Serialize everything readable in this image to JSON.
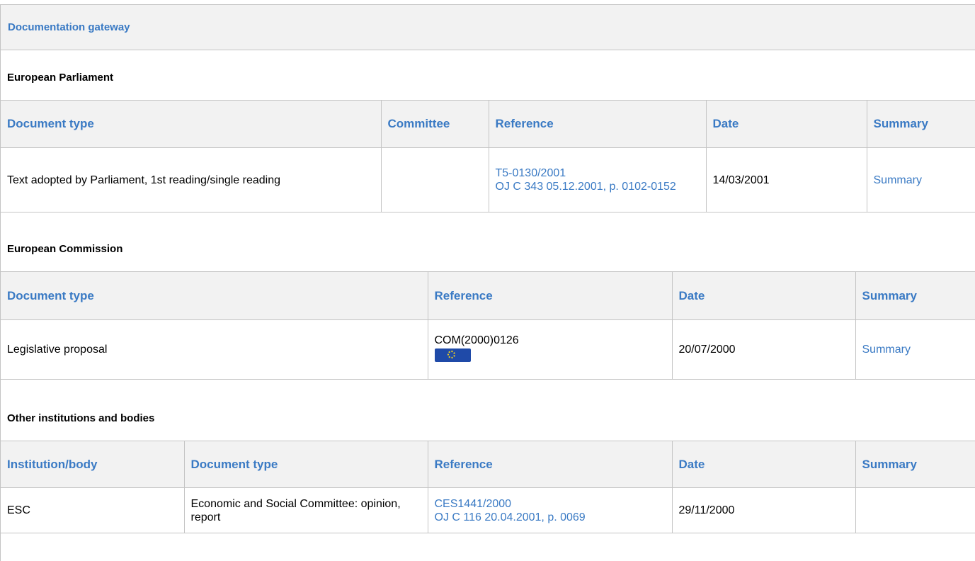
{
  "gateway": {
    "title": "Documentation gateway"
  },
  "sections": {
    "parliament": {
      "title": "European Parliament",
      "headers": [
        "Document type",
        "Committee",
        "Reference",
        "Date",
        "Summary"
      ],
      "rows": [
        {
          "document_type": "Text adopted by Parliament, 1st reading/single reading",
          "committee": "",
          "reference_lines": [
            "T5-0130/2001",
            "OJ C 343 05.12.2001, p. 0102-0152"
          ],
          "date": "14/03/2001",
          "summary": "Summary"
        }
      ]
    },
    "commission": {
      "title": "European Commission",
      "headers": [
        "Document type",
        "Reference",
        "Date",
        "Summary"
      ],
      "rows": [
        {
          "document_type": "Legislative proposal",
          "reference": "COM(2000)0126",
          "reference_icon": "eu-flag-icon",
          "date": "20/07/2000",
          "summary": "Summary"
        }
      ]
    },
    "other": {
      "title": "Other institutions and bodies",
      "headers": [
        "Institution/body",
        "Document type",
        "Reference",
        "Date",
        "Summary"
      ],
      "rows": [
        {
          "institution": "ESC",
          "document_type": "Economic and Social Committee: opinion, report",
          "reference_lines": [
            "CES1441/2000",
            "OJ C 116 20.04.2001, p. 0069"
          ],
          "date": "29/11/2000",
          "summary": ""
        }
      ]
    }
  },
  "colors": {
    "link": "#3a7ac4",
    "header_bg": "#f2f2f2",
    "border": "#c4c4c4",
    "flag_blue": "#1f4aa8",
    "flag_stars": "#f0d020"
  }
}
